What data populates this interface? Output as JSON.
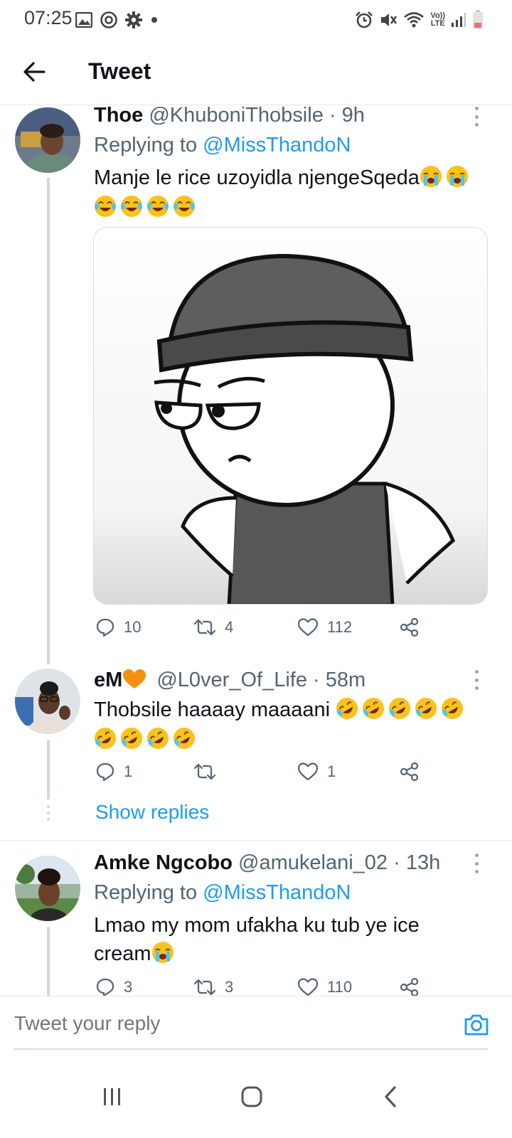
{
  "status_bar": {
    "time": "07:25",
    "left_icons": [
      "image-icon",
      "camera-ring-icon",
      "gear-icon",
      "dot-icon"
    ],
    "right_icons": [
      "alarm-icon",
      "mute-icon",
      "wifi-icon",
      "volte-icon",
      "signal-icon",
      "battery-icon"
    ],
    "volte_label_top": "Vo))",
    "volte_label_bottom": "LTE"
  },
  "header": {
    "title": "Tweet",
    "back_icon": "arrow-left-icon"
  },
  "tweets": [
    {
      "name": "Thoe",
      "handle": "@KhuboniThobsile",
      "time": "· 9h",
      "replying_to_prefix": "Replying to",
      "replying_to": "@MissThandoN",
      "text": "Manje le rice uzoyidla njengeSqeda",
      "text_emojis": [
        "loudly-crying-face",
        "loudly-crying-face"
      ],
      "text_line2_emojis": [
        "face-with-tears-of-joy",
        "face-with-tears-of-joy",
        "face-with-tears-of-joy",
        "face-with-tears-of-joy"
      ],
      "media": "cartoon-character-with-beanie",
      "replies": "10",
      "retweets": "4",
      "likes": "112"
    },
    {
      "name": "eM",
      "name_emoji": "orange-heart",
      "handle": "@L0ver_Of_Life",
      "time": "· 58m",
      "text": "Thobsile haaaay maaaani",
      "text_emojis": [
        "rolling-on-floor-laughing",
        "rolling-on-floor-laughing",
        "rolling-on-floor-laughing",
        "rolling-on-floor-laughing",
        "rolling-on-floor-laughing"
      ],
      "text_line2_emojis": [
        "rolling-on-floor-laughing",
        "rolling-on-floor-laughing",
        "rolling-on-floor-laughing",
        "rolling-on-floor-laughing"
      ],
      "replies": "1",
      "retweets": "",
      "likes": "1",
      "show_replies": "Show replies"
    },
    {
      "name": "Amke Ngcobo",
      "handle": "@amukelani_02",
      "time": "· 13h",
      "replying_to_prefix": "Replying to",
      "replying_to": "@MissThandoN",
      "text_line1": "Lmao my mom ufakha ku tub ye ice",
      "text_line2": "cream",
      "text_emojis": [
        "loudly-crying-face"
      ],
      "replies": "3",
      "retweets": "3",
      "likes": "110"
    }
  ],
  "composer": {
    "placeholder": "Tweet your reply",
    "camera_icon": "camera-icon"
  },
  "navbar": {
    "buttons": [
      "recent-apps-icon",
      "home-icon",
      "back-icon"
    ]
  },
  "colors": {
    "accent": "#1d9bf0",
    "secondary_text": "#536471",
    "thread_line": "#cfd9de"
  }
}
